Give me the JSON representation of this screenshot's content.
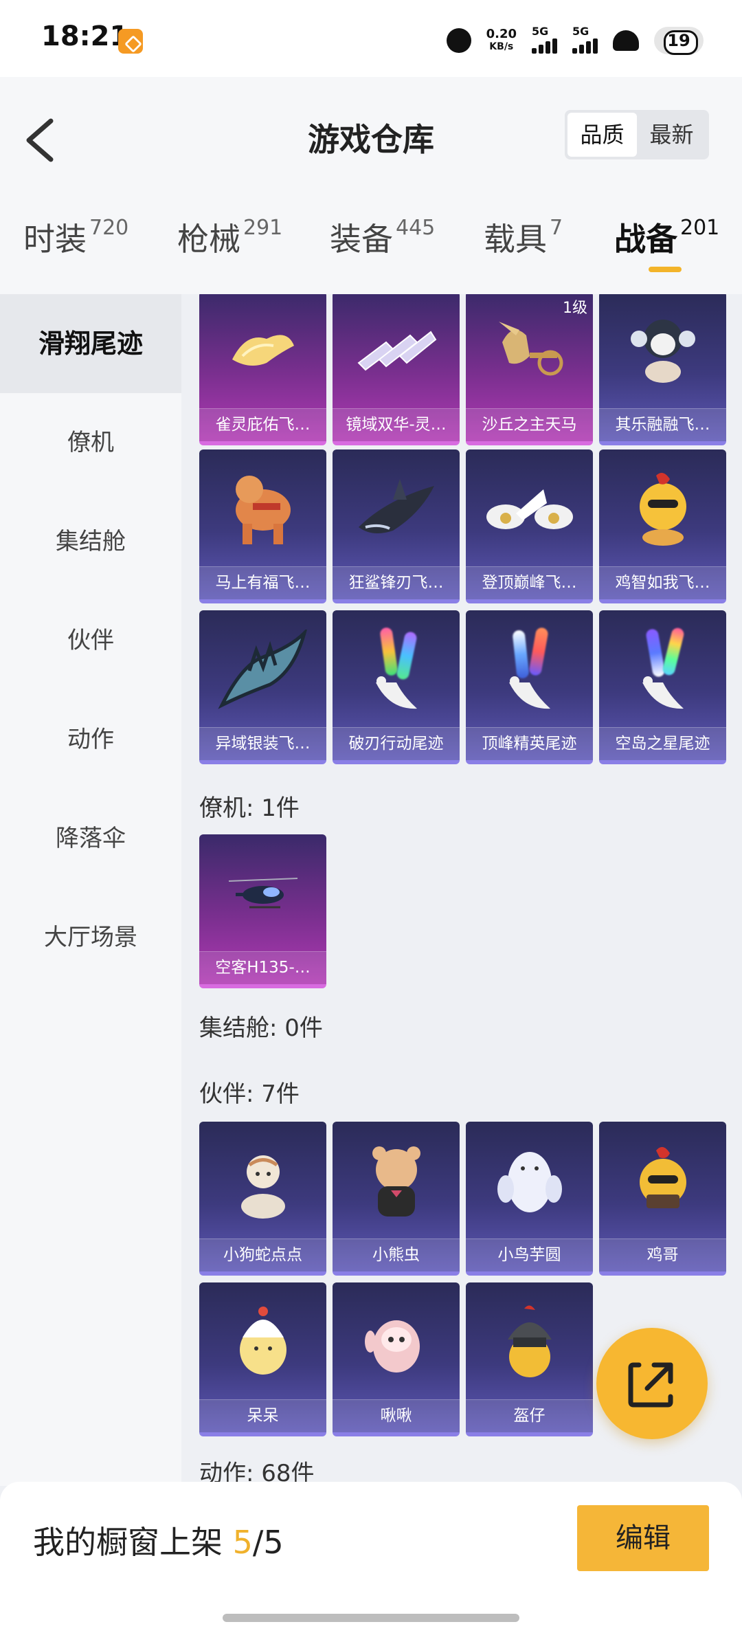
{
  "status_bar": {
    "time": "18:21",
    "net_speed_value": "0.20",
    "net_speed_unit": "KB/s",
    "signal1_label": "5G",
    "signal2_label": "5G",
    "battery": "19"
  },
  "header": {
    "title": "游戏仓库",
    "sort_options": [
      "品质",
      "最新"
    ],
    "active_sort": "品质"
  },
  "category_tabs": [
    {
      "name": "时装",
      "count": "720"
    },
    {
      "name": "枪械",
      "count": "291"
    },
    {
      "name": "装备",
      "count": "445"
    },
    {
      "name": "载具",
      "count": "7"
    },
    {
      "name": "战备",
      "count": "201",
      "active": true
    }
  ],
  "sidebar": {
    "items": [
      "滑翔尾迹",
      "僚机",
      "集结舱",
      "伙伴",
      "动作",
      "降落伞",
      "大厅场景"
    ],
    "active": "滑翔尾迹"
  },
  "trail_items": [
    {
      "name": "雀灵庇佑飞…",
      "quality": "pink"
    },
    {
      "name": "镜域双华-灵…",
      "quality": "pink"
    },
    {
      "name": "沙丘之主天马",
      "quality": "pink",
      "level": "1级"
    },
    {
      "name": "其乐融融飞…",
      "quality": "blue"
    },
    {
      "name": "马上有福飞…",
      "quality": "blue"
    },
    {
      "name": "狂鲨锋刃飞…",
      "quality": "blue"
    },
    {
      "name": "登顶巅峰飞…",
      "quality": "blue"
    },
    {
      "name": "鸡智如我飞…",
      "quality": "blue"
    },
    {
      "name": "异域银装飞…",
      "quality": "blue"
    },
    {
      "name": "破刃行动尾迹",
      "quality": "blue"
    },
    {
      "name": "顶峰精英尾迹",
      "quality": "blue"
    },
    {
      "name": "空岛之星尾迹",
      "quality": "blue"
    }
  ],
  "wingman_section": {
    "title": "僚机: 1件",
    "items": [
      {
        "name": "空客H135-…",
        "quality": "pink"
      }
    ]
  },
  "capsule_section": {
    "title": "集结舱: 0件"
  },
  "partner_section": {
    "title": "伙伴: 7件",
    "items": [
      {
        "name": "小狗蛇点点",
        "quality": "blue"
      },
      {
        "name": "小熊虫",
        "quality": "blue"
      },
      {
        "name": "小鸟芋圆",
        "quality": "blue"
      },
      {
        "name": "鸡哥",
        "quality": "blue"
      },
      {
        "name": "呆呆",
        "quality": "blue"
      },
      {
        "name": "啾啾",
        "quality": "blue"
      },
      {
        "name": "盔仔",
        "quality": "blue"
      }
    ]
  },
  "action_section": {
    "title": "动作: 68件"
  },
  "bottom_bar": {
    "showcase_label": "我的橱窗上架",
    "showcase_current": "5",
    "showcase_sep_total": "/5",
    "edit_label": "编辑"
  },
  "colors": {
    "accent": "#f3b42a",
    "pink_quality": "#b03ab3",
    "blue_quality": "#5e58b6"
  }
}
